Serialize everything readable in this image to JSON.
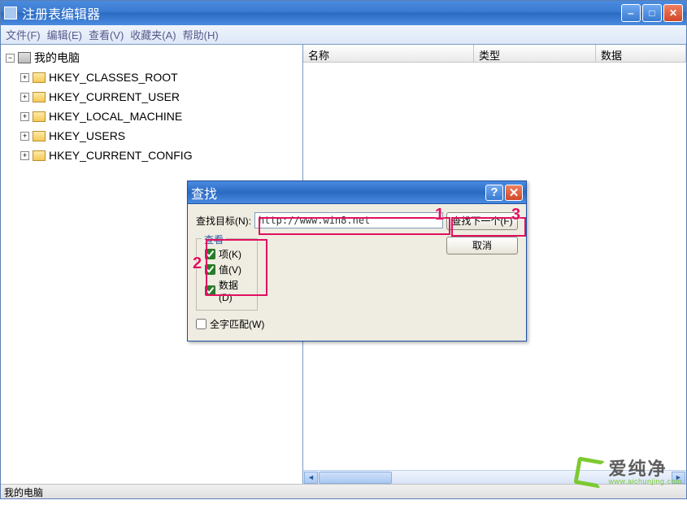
{
  "window": {
    "title": "注册表编辑器"
  },
  "menu": {
    "file": "文件(F)",
    "edit": "编辑(E)",
    "view": "查看(V)",
    "favorites": "收藏夹(A)",
    "help": "帮助(H)"
  },
  "tree": {
    "root": "我的电脑",
    "items": [
      "HKEY_CLASSES_ROOT",
      "HKEY_CURRENT_USER",
      "HKEY_LOCAL_MACHINE",
      "HKEY_USERS",
      "HKEY_CURRENT_CONFIG"
    ]
  },
  "columns": {
    "name": "名称",
    "type": "类型",
    "data": "数据"
  },
  "statusbar": {
    "path": "我的电脑"
  },
  "dialog": {
    "title": "查找",
    "find_label": "查找目标(N):",
    "find_value": "http://www.win8.net",
    "group_title": "查看",
    "chk_keys": "项(K)",
    "chk_values": "值(V)",
    "chk_data": "数据(D)",
    "chk_whole": "全字匹配(W)",
    "btn_findnext": "查找下一个(F)",
    "btn_cancel": "取消"
  },
  "annotations": {
    "a1": "1",
    "a2": "2",
    "a3": "3"
  },
  "watermark": {
    "brand": "爱纯净",
    "url": "www.aichunjing.com"
  }
}
